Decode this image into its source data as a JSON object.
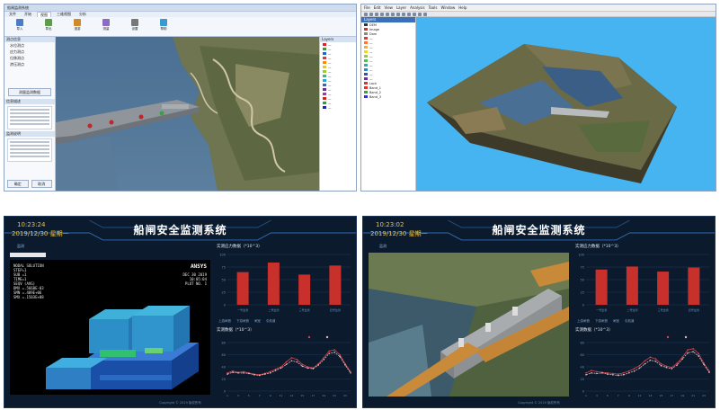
{
  "top_left": {
    "title": "船闸监测系统",
    "tabs": [
      "文件",
      "开始",
      "视图",
      "三维视图",
      "分析"
    ],
    "ribbon": [
      "导入",
      "导出",
      "漫游",
      "测量",
      "设置",
      "帮助"
    ],
    "left_pane": {
      "header": "测点信息",
      "items": [
        "水位测点",
        "应力测点",
        "位移测点",
        "渗压测点"
      ],
      "button": "测量监测数据",
      "section2": "信息描述",
      "section3": "监测说明",
      "bottom_buttons": [
        "确定",
        "取消"
      ]
    },
    "right_pane": {
      "header": "Layers"
    }
  },
  "top_right": {
    "menu": [
      "File",
      "Edit",
      "View",
      "Layer",
      "Analysis",
      "Tools",
      "Window",
      "Help"
    ],
    "layers_title": "Layers",
    "layer_items": [
      "DEM",
      "Image",
      "Dam",
      "Lock",
      "Band_1",
      "Band_2",
      "Band_3"
    ]
  },
  "bottom_left": {
    "time": "10:23:24",
    "date": "2019/12/30 星期一",
    "title": "船闸安全监测系统",
    "tab": "监测",
    "ansys_label": "ANSYS",
    "ansys_info": [
      "NODAL SOLUTION",
      "STEP=1",
      "SUB =1",
      "TIME=1",
      "SEQV (AVG)",
      "DMX =.5668E-03",
      "SMN =.489E+06",
      "SMX =.1503E+08"
    ],
    "ansys_info_r": [
      "DEC 30 2019",
      "10:05:04",
      "PLOT NO. 1"
    ],
    "chart1_title": "实测应力数据（*10^3）",
    "chart2_title": "实测数据（*10^3）",
    "subtabs": [
      "上游闸首",
      "下游闸首",
      "闸室",
      "引航道"
    ],
    "footer": "Copyright © 2019 版权所有"
  },
  "bottom_right": {
    "time": "10:23:02",
    "date": "2019/12/30 星期一",
    "title": "船闸安全监测系统",
    "tab": "监测",
    "chart1_title": "实测应力数据（*10^3）",
    "chart2_title": "实测数据（*10^3）",
    "subtabs": [
      "上游闸首",
      "下游闸首",
      "闸室",
      "引航道"
    ],
    "footer": "Copyright © 2019 版权所有"
  },
  "colors": {
    "dash_bg": "#0b1a2d",
    "bar_red": "#c8302c",
    "accent_gold": "#f0c23b",
    "sky_blue": "#45b4f0"
  },
  "chart_data": [
    {
      "type": "bar",
      "categories": [
        "一号监测",
        "二号监测",
        "三号监测",
        "四号监测"
      ],
      "values": [
        65,
        84,
        60,
        78
      ],
      "ylim": [
        0,
        100
      ]
    },
    {
      "type": "line",
      "x": [
        1,
        2,
        3,
        4,
        5,
        6,
        7,
        8,
        9,
        10,
        11,
        12,
        13,
        14,
        15,
        16,
        17,
        18,
        19,
        20,
        21,
        22,
        23,
        24
      ],
      "series": [
        {
          "values": [
            30,
            33,
            31,
            32,
            30,
            28,
            27,
            29,
            32,
            36,
            40,
            48,
            55,
            52,
            44,
            40,
            38,
            45,
            55,
            66,
            68,
            60,
            45,
            32
          ]
        },
        {
          "values": [
            28,
            31,
            30,
            30,
            29,
            27,
            26,
            28,
            30,
            34,
            38,
            44,
            50,
            48,
            41,
            38,
            37,
            43,
            52,
            62,
            64,
            57,
            43,
            30
          ]
        }
      ],
      "ylim": [
        0,
        80
      ]
    },
    {
      "type": "bar",
      "categories": [
        "一号监测",
        "二号监测",
        "三号监测",
        "四号监测"
      ],
      "values": [
        70,
        76,
        66,
        74
      ],
      "ylim": [
        0,
        100
      ]
    },
    {
      "type": "line",
      "x": [
        1,
        2,
        3,
        4,
        5,
        6,
        7,
        8,
        9,
        10,
        11,
        12,
        13,
        14,
        15,
        16,
        17,
        18,
        19,
        20,
        21,
        22,
        23,
        24
      ],
      "series": [
        {
          "values": [
            30,
            34,
            32,
            31,
            30,
            29,
            28,
            30,
            33,
            37,
            42,
            50,
            56,
            53,
            45,
            41,
            39,
            46,
            56,
            68,
            70,
            62,
            46,
            33
          ]
        },
        {
          "values": [
            27,
            30,
            29,
            30,
            28,
            27,
            26,
            27,
            30,
            33,
            38,
            45,
            51,
            49,
            42,
            39,
            37,
            43,
            53,
            63,
            65,
            58,
            44,
            31
          ]
        }
      ],
      "ylim": [
        0,
        80
      ]
    }
  ]
}
